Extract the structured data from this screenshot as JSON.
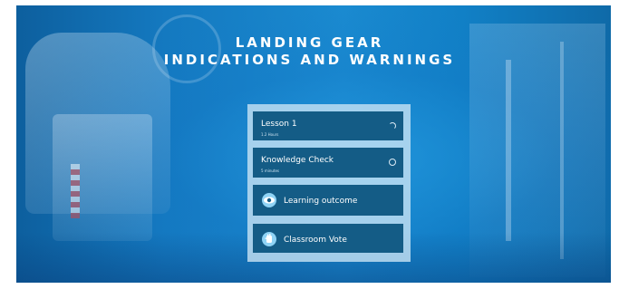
{
  "title": {
    "line1": "LANDING GEAR",
    "line2": "INDICATIONS AND WARNINGS"
  },
  "menu": {
    "items": [
      {
        "label": "Lesson 1",
        "duration": "1.2 Hours",
        "icon": "progress-ring-icon"
      },
      {
        "label": "Knowledge Check",
        "duration": "5 minutes",
        "icon": "progress-ring-icon"
      },
      {
        "label": "Learning outcome",
        "icon": "eye-icon"
      },
      {
        "label": "Classroom Vote",
        "icon": "vote-hand-icon"
      }
    ]
  },
  "colors": {
    "background": "#1479c0",
    "panel": "#cde6f5",
    "item": "#145c86",
    "icon_accent": "#8fd3f5"
  }
}
